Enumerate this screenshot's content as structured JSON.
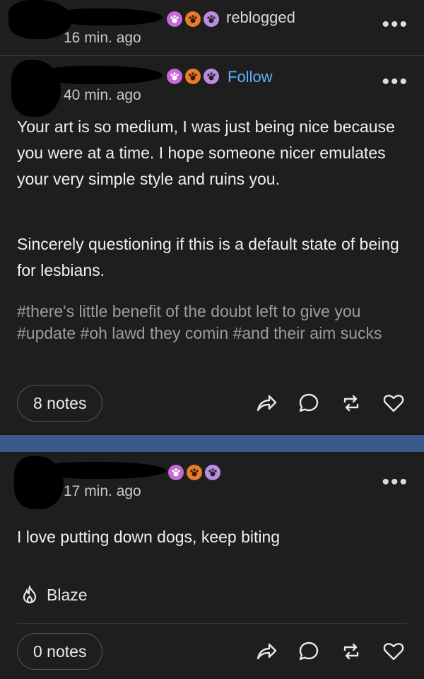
{
  "post_top": {
    "time": "16 min. ago",
    "action_label": "reblogged"
  },
  "post_main": {
    "time": "40 min. ago",
    "action_label": "Follow",
    "paragraph1": "Your art is so medium, I was just being nice because you were at a time. I hope someone nicer emulates your very simple style and ruins you.",
    "paragraph2": "Sincerely questioning if this is a default state of being for lesbians.",
    "tags": "#there's little benefit of the doubt left to give you  #update  #oh lawd they comin  #and their aim sucks",
    "notes": "8 notes"
  },
  "post_bottom": {
    "time": "17 min. ago",
    "body": "I love putting down dogs, keep biting",
    "blaze_label": "Blaze",
    "notes": "0 notes"
  },
  "colors": {
    "background": "#1e1e1e",
    "follow": "#5ab0ff",
    "band": "#3a5a8c",
    "tags": "#9c9c9c"
  },
  "icons": [
    "more-icon",
    "share-icon",
    "reply-icon",
    "reblog-icon",
    "like-icon",
    "blaze-icon",
    "paw-badge-icon"
  ]
}
